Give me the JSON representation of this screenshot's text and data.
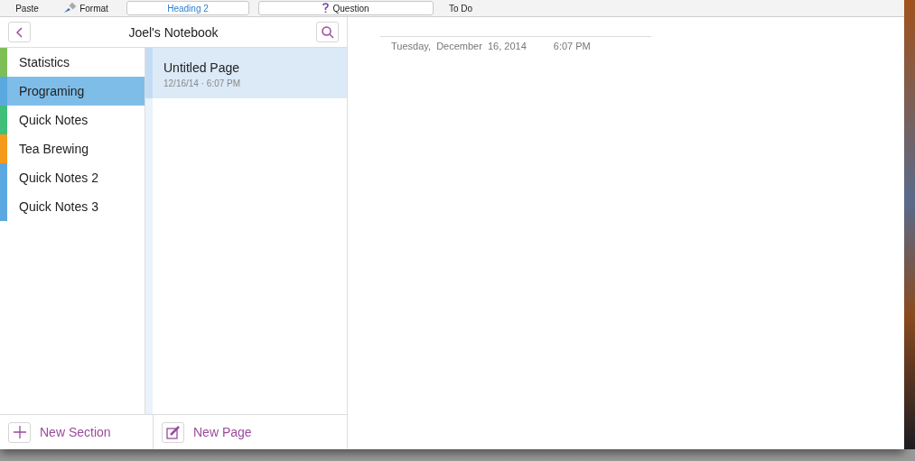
{
  "toolbar": {
    "items": [
      {
        "kind": "paste",
        "label": "Paste"
      },
      {
        "kind": "format",
        "label": "Format"
      },
      {
        "kind": "style",
        "label": "Heading 2"
      },
      {
        "kind": "tag",
        "label": "Question"
      },
      {
        "kind": "text",
        "label": "To Do"
      }
    ]
  },
  "navigator": {
    "title": "Joel's Notebook"
  },
  "sections": [
    {
      "label": "Statistics",
      "color": "#7dbf56",
      "selected": false
    },
    {
      "label": "Programing",
      "color": "#5ba8e0",
      "selected": true
    },
    {
      "label": "Quick Notes",
      "color": "#3fbf7a",
      "selected": false
    },
    {
      "label": "Tea Brewing",
      "color": "#f59a1b",
      "selected": false
    },
    {
      "label": "Quick Notes 2",
      "color": "#5ba8e0",
      "selected": false
    },
    {
      "label": "Quick Notes 3",
      "color": "#5ba8e0",
      "selected": false
    }
  ],
  "pages": [
    {
      "title": "Untitled Page",
      "date": "12/16/14",
      "separator": "·",
      "time": "6:07 PM",
      "selected": true
    }
  ],
  "footer": {
    "new_section": "New Section",
    "new_page": "New Page"
  },
  "note": {
    "date": "Tuesday,  December  16, 2014",
    "time": "6:07 PM"
  }
}
